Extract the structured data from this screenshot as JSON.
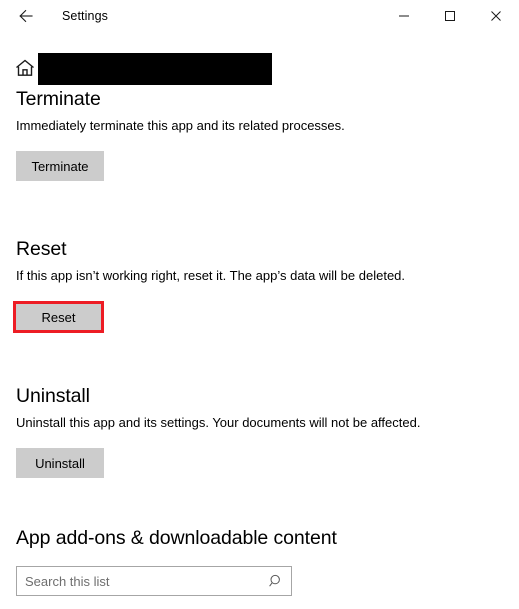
{
  "window": {
    "title": "Settings",
    "back_icon": "back-arrow-icon",
    "minimize_label": "—",
    "maximize_label": "☐",
    "close_label": "✕"
  },
  "header": {
    "home_icon": "home-icon",
    "app_name": "",
    "redacted": true
  },
  "sections": [
    {
      "id": "terminate",
      "heading": "Terminate",
      "description": "Immediately terminate this app and its related processes.",
      "button": "Terminate",
      "highlighted": false
    },
    {
      "id": "reset",
      "heading": "Reset",
      "description": "If this app isn’t working right, reset it. The app’s data will be deleted.",
      "button": "Reset",
      "highlighted": true
    },
    {
      "id": "uninstall",
      "heading": "Uninstall",
      "description": "Uninstall this app and its settings. Your documents will not be affected.",
      "button": "Uninstall",
      "highlighted": false
    }
  ],
  "addons": {
    "heading": "App add-ons & downloadable content",
    "search_placeholder": "Search this list",
    "search_value": "",
    "search_icon": "search-icon"
  },
  "colors": {
    "page_background": "#ffffff",
    "text": "#000000",
    "button_background": "#cccccc",
    "highlight_border": "#ed1c24",
    "search_border": "#a6a6a6",
    "placeholder_text": "#6e6e6e",
    "redaction": "#000000"
  }
}
